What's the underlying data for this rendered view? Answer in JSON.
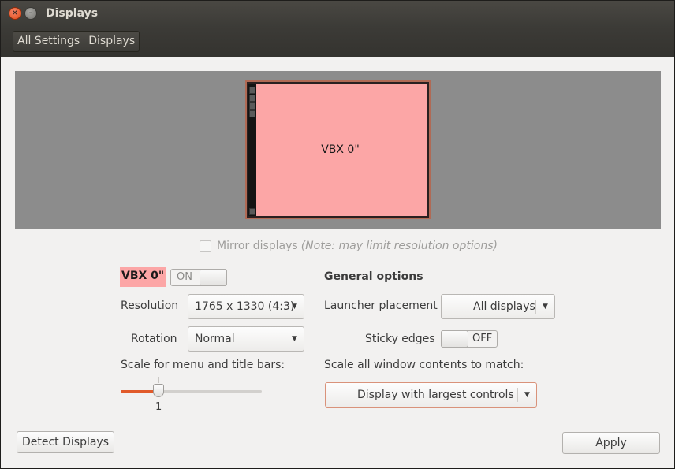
{
  "window": {
    "title": "Displays"
  },
  "breadcrumbs": [
    {
      "label": "All Settings"
    },
    {
      "label": "Displays"
    }
  ],
  "preview": {
    "monitor_label": "VBX 0\"",
    "monitor_color": "#fca6a6"
  },
  "mirror": {
    "label": "Mirror displays",
    "note": "(Note: may limit resolution options)",
    "checked": false
  },
  "display": {
    "name": "VBX 0\"",
    "switch_label": "ON",
    "resolution_label": "Resolution",
    "resolution_value": "1765 x 1330 (4:3)",
    "rotation_label": "Rotation",
    "rotation_value": "Normal",
    "scale_label": "Scale for menu and title bars:",
    "scale_value": "1"
  },
  "general": {
    "title": "General options",
    "launcher_label": "Launcher placement",
    "launcher_value": "All displays",
    "sticky_label": "Sticky edges",
    "sticky_switch_label": "OFF",
    "scale_all_label": "Scale all window contents to match:",
    "scale_all_value": "Display with largest controls"
  },
  "buttons": {
    "detect": "Detect Displays",
    "apply": "Apply"
  },
  "icons": {
    "close": "close-icon",
    "minimize": "minimize-icon",
    "dropdown": "chevron-down-icon"
  },
  "colors": {
    "accent": "#e15a2a",
    "titlebar": "#3c3b37",
    "background": "#f2f1f0"
  }
}
